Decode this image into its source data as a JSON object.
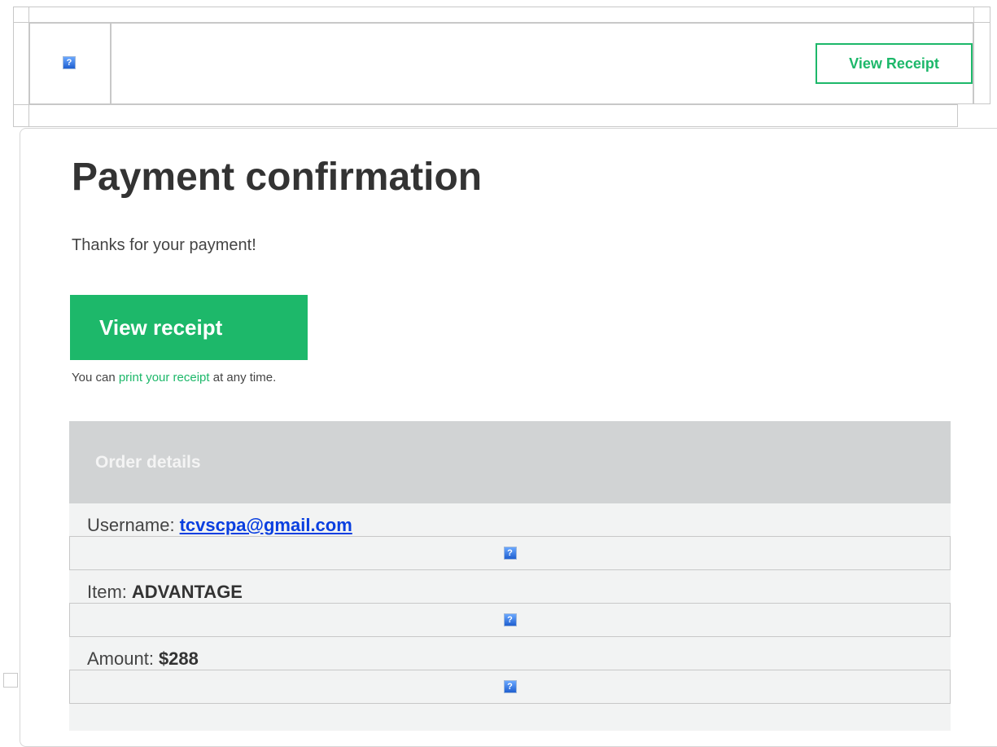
{
  "header": {
    "view_receipt_label": "View Receipt"
  },
  "main": {
    "title": "Payment confirmation",
    "thanks": "Thanks for your payment!",
    "view_receipt_button": "View receipt",
    "note_prefix": "You can ",
    "note_link": "print your receipt",
    "note_suffix": " at any time."
  },
  "order": {
    "heading": "Order details",
    "rows": [
      {
        "label": "Username:",
        "value": "tcvscpa@gmail.com"
      },
      {
        "label": "Item:",
        "value": "ADVANTAGE"
      },
      {
        "label": "Amount:",
        "value": "$288"
      }
    ]
  },
  "icons": {
    "broken_image": "question-mark-icon"
  },
  "colors": {
    "accent": "#1db86a",
    "link": "#0a3fe0",
    "panel_header": "#d1d3d4"
  }
}
